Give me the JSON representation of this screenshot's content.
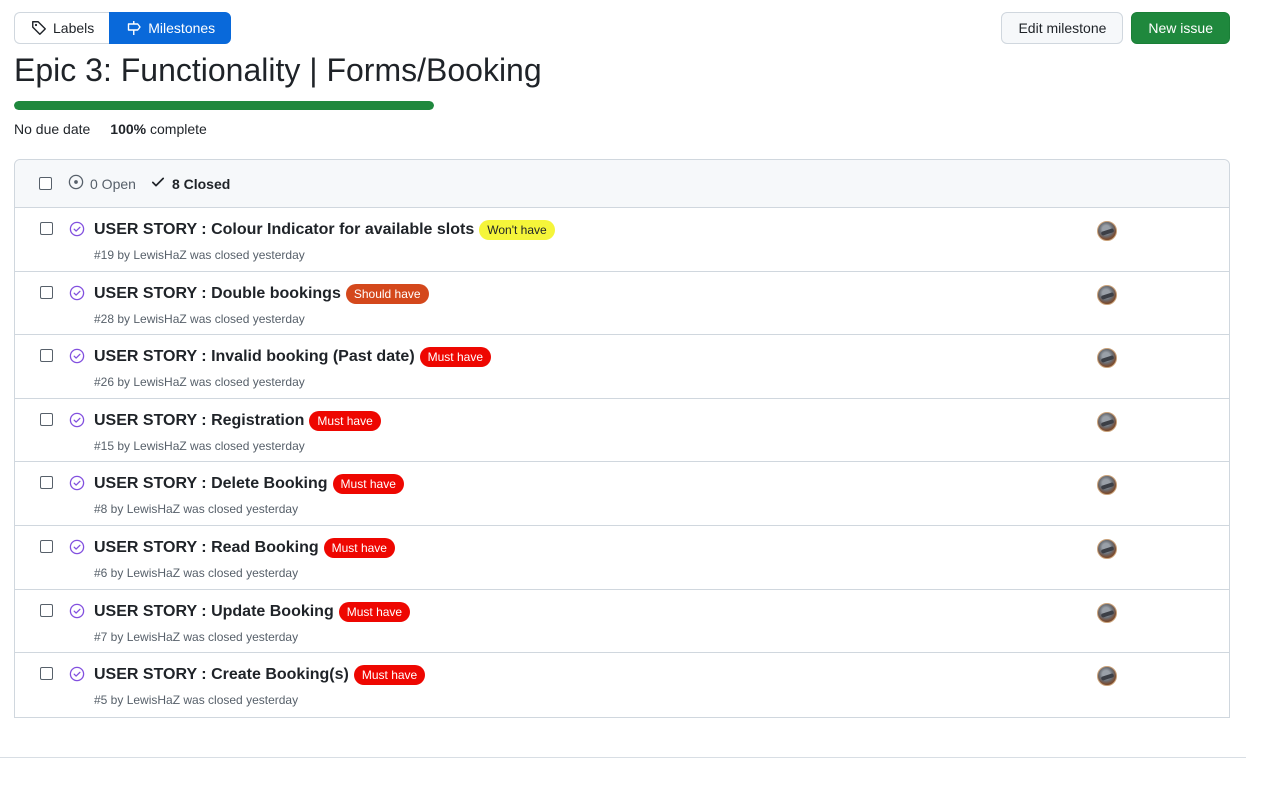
{
  "nav": {
    "labels": "Labels",
    "milestones": "Milestones"
  },
  "actions": {
    "edit": "Edit milestone",
    "new_issue": "New issue"
  },
  "milestone": {
    "title": "Epic 3: Functionality | Forms/Booking",
    "due": "No due date",
    "percent": "100%",
    "complete_suffix": " complete",
    "progress_fraction": 1.0
  },
  "states": {
    "open": "0 Open",
    "closed": "8 Closed"
  },
  "issues": [
    {
      "title": "USER STORY : Colour Indicator for available slots",
      "label": "Won't have",
      "meta": "#19 by LewisHaZ was closed yesterday"
    },
    {
      "title": "USER STORY : Double bookings",
      "label": "Should have",
      "meta": "#28 by LewisHaZ was closed yesterday"
    },
    {
      "title": "USER STORY : Invalid booking (Past date)",
      "label": "Must have",
      "meta": "#26 by LewisHaZ was closed yesterday"
    },
    {
      "title": "USER STORY : Registration",
      "label": "Must have",
      "meta": "#15 by LewisHaZ was closed yesterday"
    },
    {
      "title": "USER STORY : Delete Booking",
      "label": "Must have",
      "meta": "#8 by LewisHaZ was closed yesterday"
    },
    {
      "title": "USER STORY : Read Booking",
      "label": "Must have",
      "meta": "#6 by LewisHaZ was closed yesterday"
    },
    {
      "title": "USER STORY : Update Booking",
      "label": "Must have",
      "meta": "#7 by LewisHaZ was closed yesterday"
    },
    {
      "title": "USER STORY : Create Booking(s)",
      "label": "Must have",
      "meta": "#5 by LewisHaZ was closed yesterday"
    }
  ],
  "label_colors": {
    "Won't have": {
      "bg": "#f5f53a",
      "fg": "#1f2328"
    },
    "Should have": {
      "bg": "#d4481c",
      "fg": "#ffffff"
    },
    "Must have": {
      "bg": "#ee0701",
      "fg": "#ffffff"
    }
  },
  "colors": {
    "primary": "#0969da",
    "success": "#1f883d",
    "closed_icon": "#8250df"
  },
  "icons": {
    "labels": "tag-icon",
    "milestones": "milestone-icon",
    "open": "issue-opened-icon",
    "closed": "check-icon",
    "issue_state": "issue-closed-icon"
  }
}
